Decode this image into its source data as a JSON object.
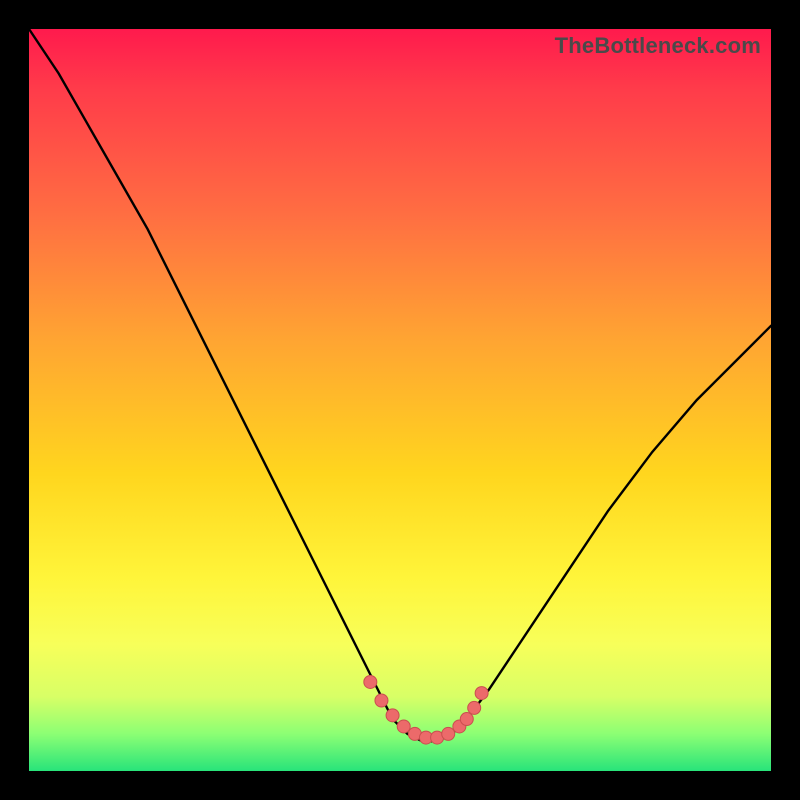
{
  "attribution": "TheBottleneck.com",
  "colors": {
    "frame": "#000000",
    "grad_top": "#ff1a4d",
    "grad_mid": "#ffd61e",
    "grad_bot": "#28e47a",
    "curve": "#000000",
    "marker_fill": "#ec6a6a",
    "marker_stroke": "#c94f4f"
  },
  "chart_data": {
    "type": "line",
    "title": "",
    "xlabel": "",
    "ylabel": "",
    "xlim": [
      0,
      100
    ],
    "ylim": [
      0,
      100
    ],
    "series": [
      {
        "name": "bottleneck-curve",
        "x": [
          0,
          4,
          8,
          12,
          16,
          20,
          24,
          28,
          32,
          36,
          40,
          44,
          47,
          49,
          51,
          53,
          55,
          57,
          59,
          62,
          66,
          72,
          78,
          84,
          90,
          96,
          100
        ],
        "y": [
          100,
          94,
          87,
          80,
          73,
          65,
          57,
          49,
          41,
          33,
          25,
          17,
          11,
          7,
          5,
          4,
          4,
          5,
          7,
          11,
          17,
          26,
          35,
          43,
          50,
          56,
          60
        ]
      }
    ],
    "markers": {
      "name": "highlighted-points",
      "x": [
        46,
        47.5,
        49,
        50.5,
        52,
        53.5,
        55,
        56.5,
        58,
        59,
        60,
        61
      ],
      "y": [
        12,
        9.5,
        7.5,
        6,
        5,
        4.5,
        4.5,
        5,
        6,
        7,
        8.5,
        10.5
      ]
    }
  }
}
